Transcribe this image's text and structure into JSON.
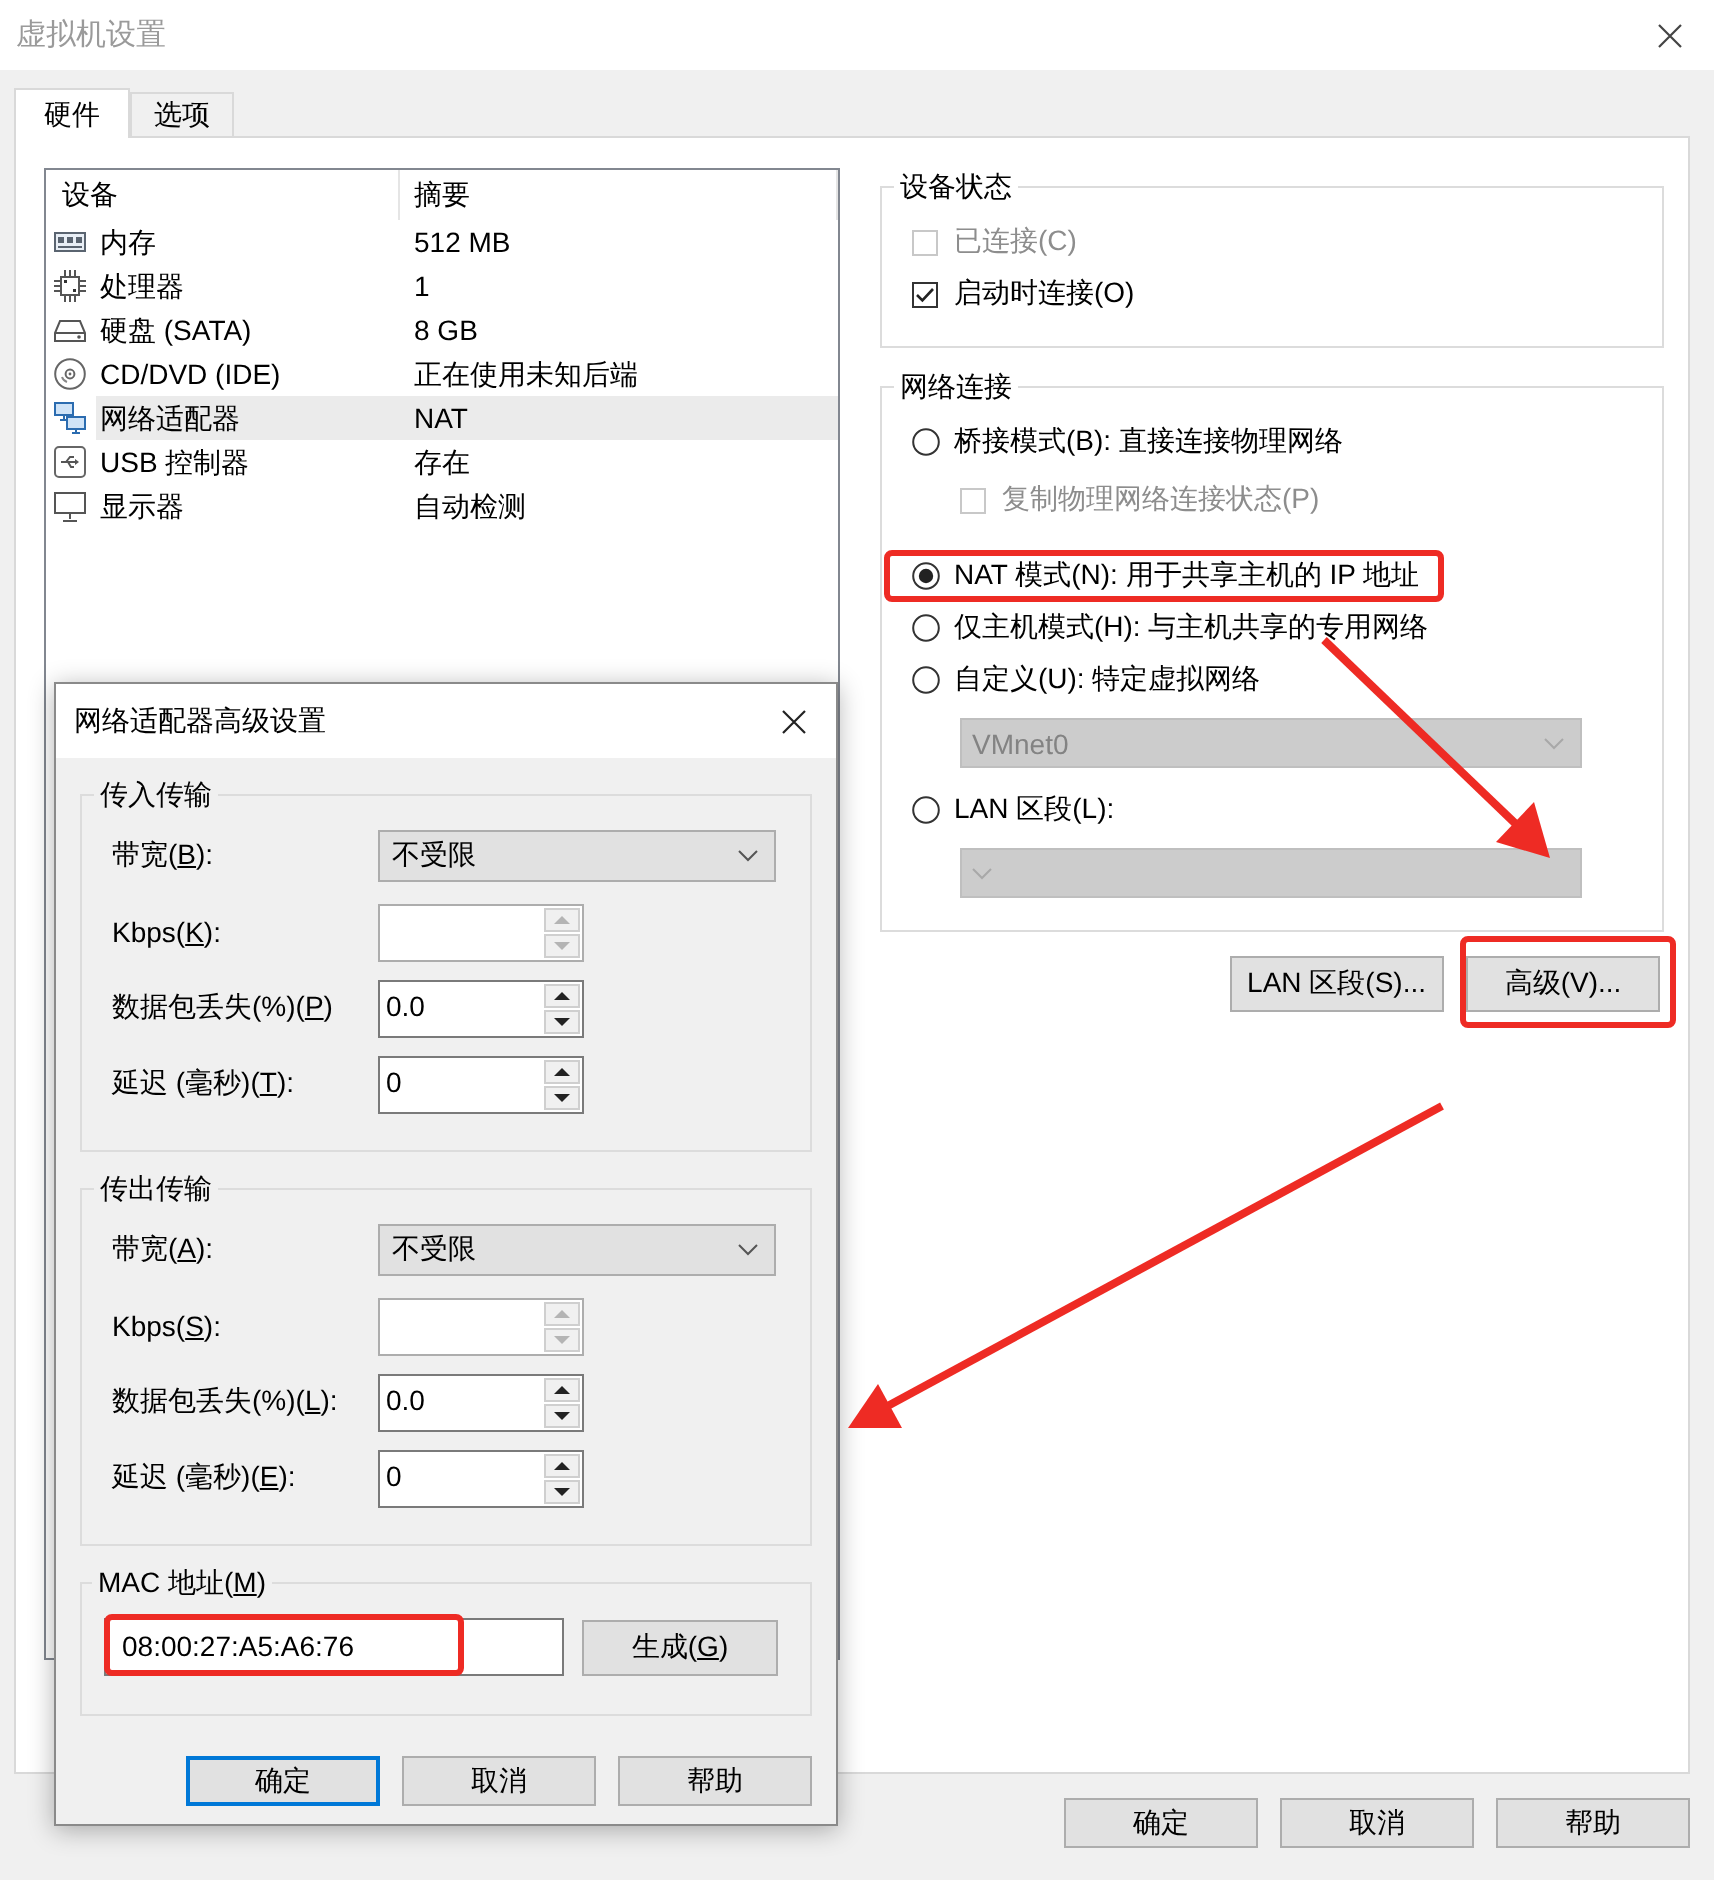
{
  "window": {
    "title": "虚拟机设置"
  },
  "tabs": [
    {
      "label": "硬件",
      "selected": true
    },
    {
      "label": "选项",
      "selected": false
    }
  ],
  "device_table": {
    "columns": [
      "设备",
      "摘要"
    ],
    "rows": [
      {
        "kind": "memory",
        "device": "内存",
        "summary": "512 MB",
        "selected": false
      },
      {
        "kind": "processor",
        "device": "处理器",
        "summary": "1",
        "selected": false
      },
      {
        "kind": "hard_disk",
        "device": "硬盘 (SATA)",
        "summary": "8 GB",
        "selected": false
      },
      {
        "kind": "cd_dvd",
        "device": "CD/DVD (IDE)",
        "summary": "正在使用未知后端",
        "selected": false
      },
      {
        "kind": "network_adapter",
        "device": "网络适配器",
        "summary": "NAT",
        "selected": true
      },
      {
        "kind": "usb",
        "device": "USB 控制器",
        "summary": "存在",
        "selected": false
      },
      {
        "kind": "display",
        "device": "显示器",
        "summary": "自动检测",
        "selected": false
      }
    ]
  },
  "device_status": {
    "title": "设备状态",
    "options": [
      {
        "label": "已连接(C)",
        "checked": false,
        "disabled": true
      },
      {
        "label": "启动时连接(O)",
        "checked": true,
        "disabled": false
      }
    ]
  },
  "network_connection": {
    "title": "网络连接",
    "items": [
      {
        "kind": "radio",
        "label": "桥接模式(B): 直接连接物理网络",
        "selected": false,
        "disabled": false,
        "highlighted": false
      },
      {
        "kind": "checkbox",
        "label": "复制物理网络连接状态(P)",
        "checked": false,
        "disabled": true,
        "highlighted": false
      },
      {
        "kind": "radio",
        "label": "NAT 模式(N): 用于共享主机的 IP 地址",
        "selected": true,
        "disabled": false,
        "highlighted": true
      },
      {
        "kind": "radio",
        "label": "仅主机模式(H): 与主机共享的专用网络",
        "selected": false,
        "disabled": false,
        "highlighted": false
      },
      {
        "kind": "radio",
        "label": "自定义(U): 特定虚拟网络",
        "selected": false,
        "disabled": false,
        "highlighted": false
      },
      {
        "kind": "dropdown",
        "value": "VMnet0",
        "disabled": true,
        "highlighted": false
      },
      {
        "kind": "radio",
        "label": "LAN 区段(L):",
        "selected": false,
        "disabled": false,
        "highlighted": false
      },
      {
        "kind": "dropdown",
        "disabled": true,
        "highlighted": false
      }
    ]
  },
  "network_buttons": [
    {
      "label": "LAN 区段(S)...",
      "highlighted": false
    },
    {
      "label": "高级(V)...",
      "highlighted": true
    }
  ],
  "footer_buttons": [
    "确定",
    "取消",
    "帮助"
  ],
  "advanced_dialog": {
    "title": "网络适配器高级设置",
    "groups": [
      {
        "title": "传入传输",
        "fields": [
          {
            "kind": "dropdown",
            "label": {
              "before": "带宽(",
              "key": "B",
              "after": "):"
            },
            "value": "不受限",
            "disabled": false
          },
          {
            "kind": "spin",
            "label": {
              "before": "Kbps(",
              "key": "K",
              "after": "):"
            },
            "disabled": true
          },
          {
            "kind": "spin",
            "label": {
              "before": "数据包丢失(%)(",
              "key": "P",
              "after": ")"
            },
            "value": "0.0",
            "disabled": false
          },
          {
            "kind": "spin",
            "label": {
              "before": "延迟 (毫秒)(",
              "key": "T",
              "after": "):"
            },
            "value": "0",
            "disabled": false
          }
        ]
      },
      {
        "title": "传出传输",
        "fields": [
          {
            "kind": "dropdown",
            "label": {
              "before": "带宽(",
              "key": "A",
              "after": "):"
            },
            "value": "不受限",
            "disabled": false
          },
          {
            "kind": "spin",
            "label": {
              "before": "Kbps(",
              "key": "S",
              "after": "):"
            },
            "disabled": true
          },
          {
            "kind": "spin",
            "label": {
              "before": "数据包丢失(%)(",
              "key": "L",
              "after": "):"
            },
            "value": "0.0",
            "disabled": false
          },
          {
            "kind": "spin",
            "label": {
              "before": "延迟 (毫秒)(",
              "key": "E",
              "after": "):"
            },
            "value": "0",
            "disabled": false
          }
        ]
      }
    ],
    "mac": {
      "label": {
        "before": "MAC 地址(",
        "key": "M",
        "after": ")"
      },
      "value": "08:00:27:A5:A6:76",
      "highlighted": true,
      "button": {
        "before": "生成(",
        "key": "G",
        "after": ")"
      }
    },
    "buttons": [
      {
        "label": "确定",
        "focused": true
      },
      {
        "label": "取消",
        "focused": false
      },
      {
        "label": "帮助",
        "focused": false
      }
    ]
  }
}
